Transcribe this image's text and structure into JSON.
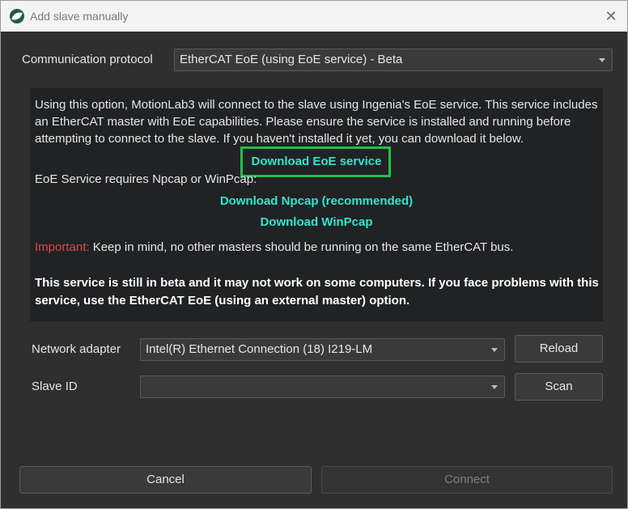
{
  "window": {
    "title": "Add slave manually",
    "icon": "motionlab-leaf-icon",
    "close_glyph": "✕"
  },
  "protocol": {
    "label": "Communication protocol",
    "value": "EtherCAT EoE (using EoE service) - Beta"
  },
  "info": {
    "description": "Using this option, MotionLab3 will connect to the slave using Ingenia's EoE service. This service includes an EtherCAT master with EoE capabilities. Please ensure the service is installed and running before attempting to connect to the slave. If you haven't installed it yet, you can download it below.",
    "download_eoe": "Download EoE service",
    "requires_text": "EoE Service requires Npcap or WinPcap:",
    "download_npcap": "Download Npcap (recommended)",
    "download_winpcap": "Download WinPcap",
    "important_label": "Important:",
    "important_text": " Keep in mind, no other masters should be running on the same EtherCAT bus.",
    "beta_note": "This service is still in beta and it may not work on some computers. If you face problems with this service, use the EtherCAT EoE (using an external master) option."
  },
  "network": {
    "label": "Network adapter",
    "value": "Intel(R) Ethernet Connection (18) I219-LM",
    "reload_label": "Reload"
  },
  "slave": {
    "label": "Slave ID",
    "value": "",
    "scan_label": "Scan"
  },
  "footer": {
    "cancel_label": "Cancel",
    "connect_label": "Connect"
  },
  "colors": {
    "link": "#2ee7d0",
    "highlight_box": "#1ec24a",
    "important": "#d94b4b",
    "background": "#2f2f2f",
    "panel": "#202224"
  }
}
